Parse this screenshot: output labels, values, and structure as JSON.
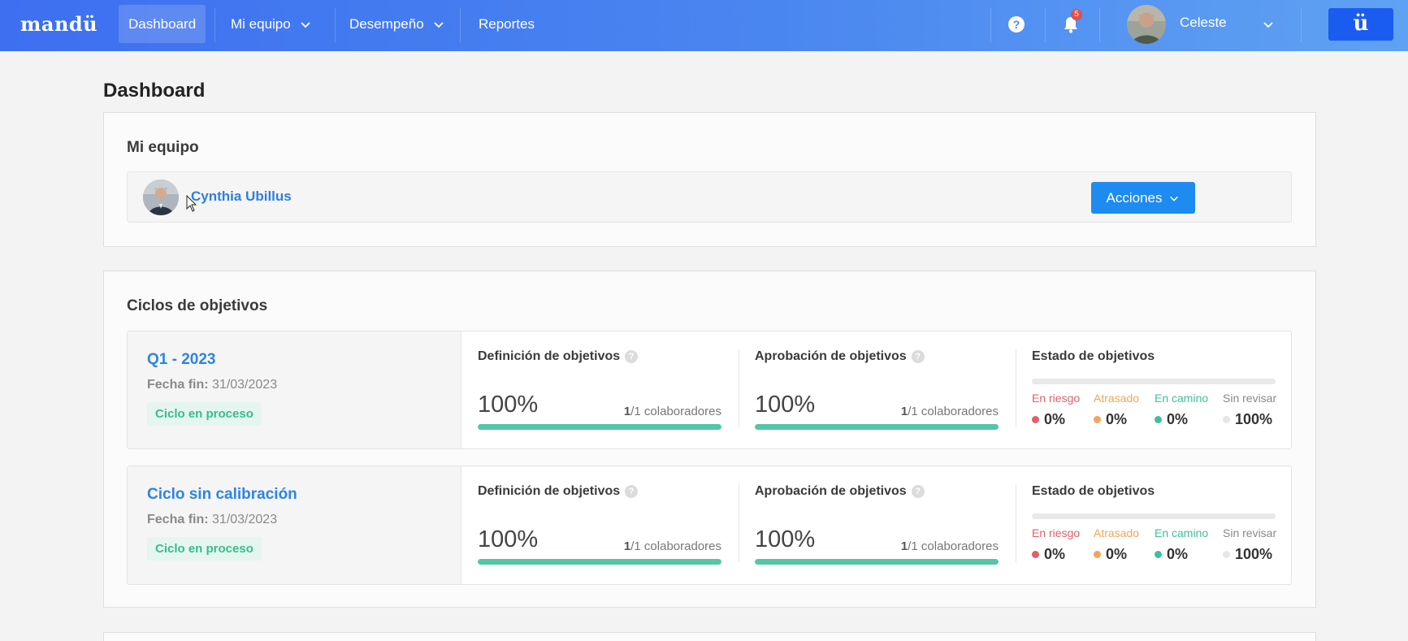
{
  "nav": {
    "logo": "mandü",
    "items": [
      {
        "label": "Dashboard"
      },
      {
        "label": "Mi equipo"
      },
      {
        "label": "Desempeño"
      },
      {
        "label": "Reportes"
      }
    ],
    "help_symbol": "?",
    "notification_count": "5",
    "user_name": "Celeste",
    "brand_button_label": "ü"
  },
  "page": {
    "title": "Dashboard"
  },
  "team": {
    "title": "Mi equipo",
    "member_name": "Cynthia Ubillus",
    "actions_label": "Acciones"
  },
  "cycles": {
    "title": "Ciclos de objetivos",
    "items": [
      {
        "name": "Q1 - 2023",
        "fecha_label": "Fecha fin:",
        "fecha_value": "31/03/2023",
        "status": "Ciclo en proceso",
        "definicion": {
          "title": "Definición de objetivos",
          "pct": "100%",
          "done": "1",
          "total": "/1 colaboradores",
          "progress": 1.0
        },
        "aprobacion": {
          "title": "Aprobación de objetivos",
          "pct": "100%",
          "done": "1",
          "total": "/1 colaboradores",
          "progress": 1.0
        },
        "estado": {
          "title": "Estado de objetivos",
          "stats": [
            {
              "label": "En riesgo",
              "value": "0%",
              "color": "#e0606a"
            },
            {
              "label": "Atrasado",
              "value": "0%",
              "color": "#f2a55a"
            },
            {
              "label": "En camino",
              "value": "0%",
              "color": "#3fbf9c"
            },
            {
              "label": "Sin revisar",
              "value": "100%",
              "color": "#e6e6e6"
            }
          ]
        }
      },
      {
        "name": "Ciclo sin calibración",
        "fecha_label": "Fecha fin:",
        "fecha_value": "31/03/2023",
        "status": "Ciclo en proceso",
        "definicion": {
          "title": "Definición de objetivos",
          "pct": "100%",
          "done": "1",
          "total": "/1 colaboradores",
          "progress": 1.0
        },
        "aprobacion": {
          "title": "Aprobación de objetivos",
          "pct": "100%",
          "done": "1",
          "total": "/1 colaboradores",
          "progress": 1.0
        },
        "estado": {
          "title": "Estado de objetivos",
          "stats": [
            {
              "label": "En riesgo",
              "value": "0%",
              "color": "#e0606a"
            },
            {
              "label": "Atrasado",
              "value": "0%",
              "color": "#f2a55a"
            },
            {
              "label": "En camino",
              "value": "0%",
              "color": "#3fbf9c"
            },
            {
              "label": "Sin revisar",
              "value": "100%",
              "color": "#e6e6e6"
            }
          ]
        }
      }
    ]
  },
  "colors": {
    "accent": "#1d8bf0",
    "nav_start": "#3d6ff0",
    "nav_end": "#5fa2f3",
    "progress": "#52c6a6",
    "status_bg": "#e4f6ef",
    "status_text": "#3bbb8e"
  },
  "icons": [
    "chevron-down-icon",
    "help-icon",
    "bell-icon",
    "user-avatar",
    "cursor-icon"
  ]
}
